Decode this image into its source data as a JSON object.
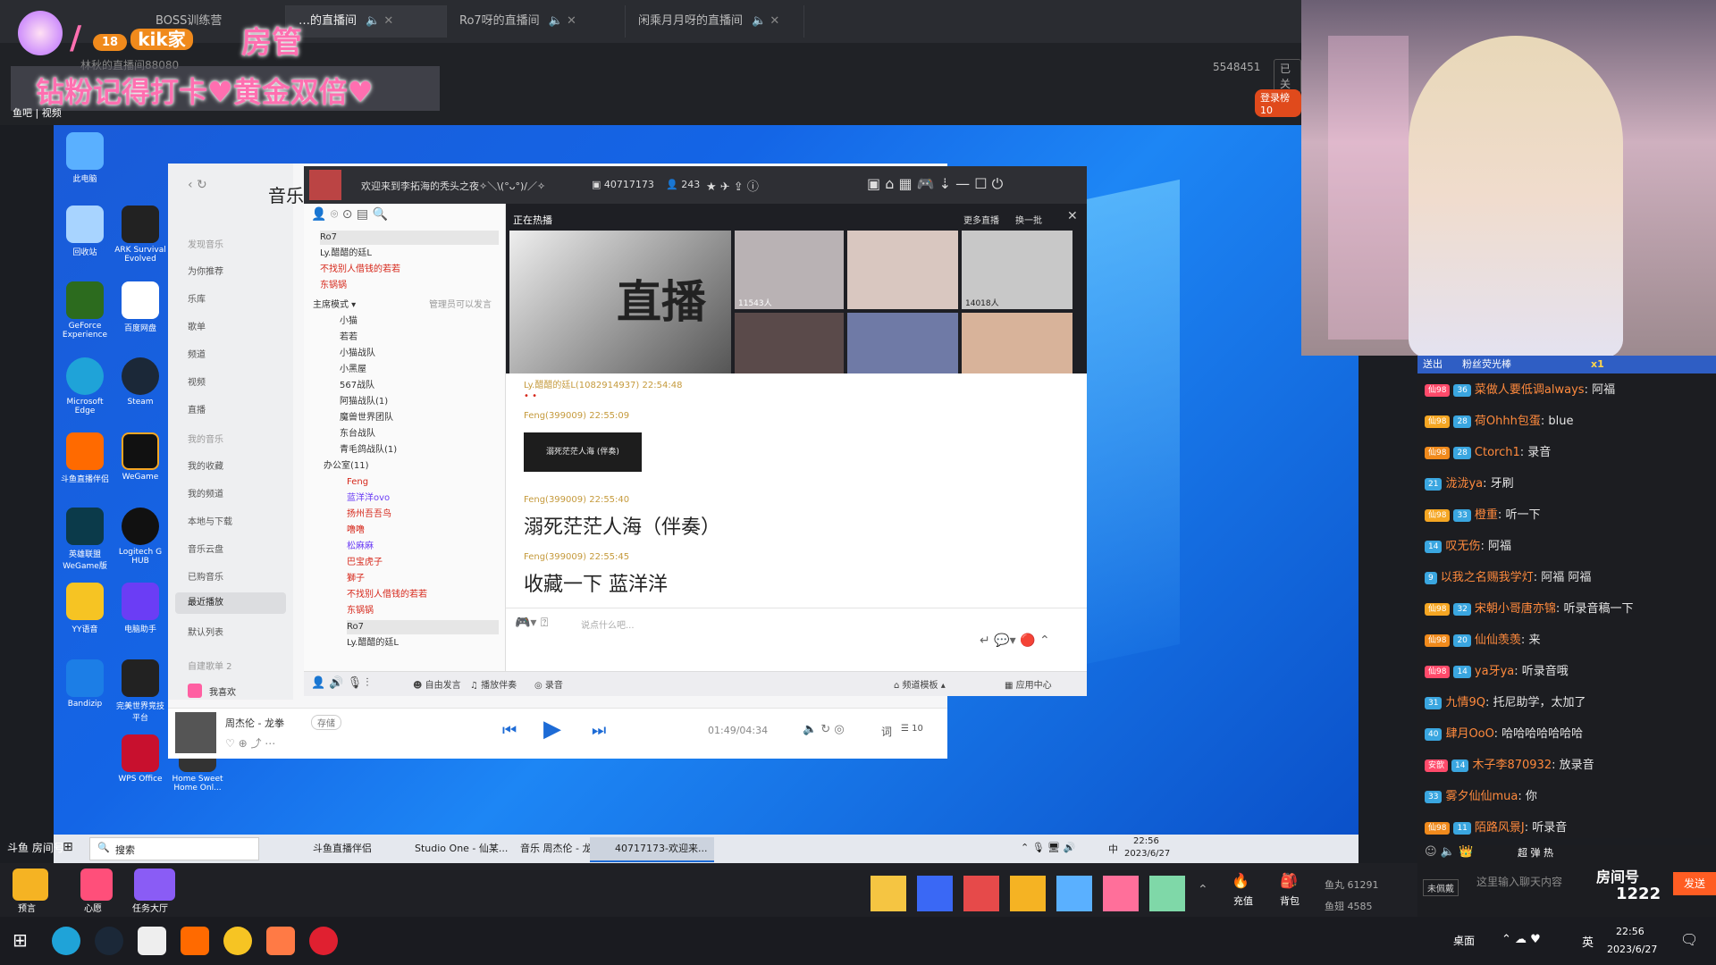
{
  "browser_tabs": [
    {
      "label": "BOSS训练营",
      "active": false
    },
    {
      "label": "…的直播间",
      "active": true
    },
    {
      "label": "Ro7呀的直播间",
      "active": false
    },
    {
      "label": "闲乘月月呀的直播间",
      "active": false
    }
  ],
  "overlay": {
    "level": "18",
    "fan_club": "kik家",
    "role": "房管",
    "banner": "钻粉记得打卡♥黄金双倍♥",
    "room_line": "林秋的直播间88080",
    "caption": "鱼吧 | 视频",
    "follow_count": "5548451",
    "follow_label": "已关",
    "rank_badge": "登录榜 10"
  },
  "desktop_icons": [
    {
      "label": "此电脑",
      "name": "this-pc-icon"
    },
    {
      "label": "回收站",
      "name": "recycle-bin-icon"
    },
    {
      "label": "ARK Survival Evolved",
      "name": "ark-icon"
    },
    {
      "label": "GeForce Experience",
      "name": "geforce-icon"
    },
    {
      "label": "百度网盘",
      "name": "baidu-pan-icon"
    },
    {
      "label": "Microsoft Edge",
      "name": "edge-icon"
    },
    {
      "label": "Steam",
      "name": "steam-icon"
    },
    {
      "label": "斗鱼直播伴侣",
      "name": "douyu-companion-icon"
    },
    {
      "label": "WeGame",
      "name": "wegame-icon"
    },
    {
      "label": "英雄联盟WeGame版",
      "name": "lol-icon"
    },
    {
      "label": "Logitech G HUB",
      "name": "ghub-icon"
    },
    {
      "label": "YY语音",
      "name": "yy-icon"
    },
    {
      "label": "电脑助手",
      "name": "pc-assistant-icon"
    },
    {
      "label": "Bandizip",
      "name": "bandizip-icon"
    },
    {
      "label": "完美世界竞技平台",
      "name": "perfect-world-icon"
    },
    {
      "label": "WPS Office",
      "name": "wps-icon"
    },
    {
      "label": "Home Sweet Home Onl...",
      "name": "home-sweet-home-icon"
    }
  ],
  "music_app": {
    "title": "音乐",
    "sections": {
      "discover": "发现音乐",
      "mine": "我的音乐",
      "created": "自建歌单 2"
    },
    "menu": [
      "为你推荐",
      "乐库",
      "歌单",
      "频道",
      "视频",
      "直播"
    ],
    "my_menu": [
      "我的收藏",
      "我的频道",
      "本地与下载",
      "音乐云盘",
      "已购音乐",
      "最近播放",
      "默认列表"
    ],
    "playlist": "我喜欢",
    "player": {
      "song": "周杰伦 - 龙拳",
      "tag": "存储",
      "time": "01:49/04:34",
      "lyrics_btn": "词",
      "queue": "10"
    }
  },
  "yy": {
    "welcome": "欢迎来到李拓海的秃头之夜✧＼\\(°ᴗ°)/／✧",
    "channel_id": "40717173",
    "online": "243",
    "hot_title": "正在热播",
    "more_live": "更多直播",
    "refresh": "换一批",
    "live_banner": "直播",
    "thumb_counts": [
      "11543人",
      "14018人"
    ],
    "admin_note": "管理员可以发言",
    "mode": "主席模式",
    "top_members": [
      "Ro7",
      "Ly.醋醋的廷L",
      "不找别人借钱的若若",
      "东锅锅"
    ],
    "groups": [
      "小猫",
      "若若",
      "小猫战队",
      "小黑屋",
      "567战队",
      "阿猫战队(1)",
      "魔兽世界团队",
      "东台战队",
      "青毛鸽战队(1)"
    ],
    "office": "办公室(11)",
    "office_members": [
      "Feng",
      "蓝洋洋ovo",
      "扬州吾吾鸟",
      "噜噜",
      "松麻麻",
      "巴宝虎子",
      "獅子",
      "不找别人借钱的若若",
      "东锅锅",
      "Ro7",
      "Ly.醋醋的廷L"
    ],
    "messages": [
      {
        "user": "Ly.醋醋的廷L(1082914937)",
        "time": "22:54:48",
        "text": "• •"
      },
      {
        "user": "Feng(399009)",
        "time": "22:55:09",
        "card": "溺死茫茫人海 (伴奏)"
      },
      {
        "user": "Feng(399009)",
        "time": "22:55:40",
        "text": "溺死茫茫人海（伴奏）"
      },
      {
        "user": "Feng(399009)",
        "time": "22:55:45",
        "text": "收藏一下  蓝洋洋"
      }
    ],
    "input_placeholder": "说点什么吧...",
    "bottom": {
      "free_speech": "自由发言",
      "accompany": "播放伴奏",
      "record": "录音",
      "channel_mode": "频道模板",
      "app_center": "应用中心"
    }
  },
  "inner_taskbar": {
    "search": "搜索",
    "items": [
      {
        "label": "斗鱼直播伴侣",
        "active": false
      },
      {
        "label": "Studio One - 仙某...",
        "active": false
      },
      {
        "label": "音乐 周杰伦 - 龙拳 ...",
        "active": false
      },
      {
        "label": "40717173-欢迎来...",
        "active": true
      }
    ],
    "ime": "中",
    "time": "22:56",
    "date": "2023/6/27"
  },
  "chat_header": {
    "left": "送出",
    "right": "粉丝荧光棒",
    "mult": "x1"
  },
  "chat": [
    {
      "lvl": "仙98",
      "badge": "36",
      "user": "菜做人要低调always",
      "msg": "阿福",
      "ucolor": "#ff8a3d"
    },
    {
      "lvl": "仙98",
      "badge": "28",
      "user": "荷Ohhh包蛋",
      "msg": "blue",
      "ucolor": "#ff8a3d"
    },
    {
      "lvl": "仙98",
      "badge": "28",
      "user": "Ctorch1",
      "msg": "录音",
      "ucolor": "#ff8a3d"
    },
    {
      "lvl": "",
      "badge": "21",
      "user": "泷泷ya",
      "msg": "牙刷",
      "ucolor": "#ff8a3d"
    },
    {
      "lvl": "仙98",
      "badge": "33",
      "user": "橙重",
      "msg": "听一下",
      "ucolor": "#ff8a3d"
    },
    {
      "lvl": "",
      "badge": "14",
      "user": "叹无伤",
      "msg": "阿福",
      "ucolor": "#ff8a3d"
    },
    {
      "lvl": "",
      "badge": "9",
      "user": "以我之名赐我学灯",
      "msg": "阿福 阿福",
      "ucolor": "#ff8a3d"
    },
    {
      "lvl": "仙98",
      "badge": "32",
      "user": "宋朝小哥唐亦锦",
      "msg": "听录音稿一下",
      "ucolor": "#ff8a3d"
    },
    {
      "lvl": "仙98",
      "badge": "20",
      "user": "仙仙羡羡",
      "msg": "来",
      "ucolor": "#ff8a3d"
    },
    {
      "lvl": "仙98",
      "badge": "14",
      "user": "ya牙ya",
      "msg": "听录音哦",
      "ucolor": "#ff8a3d"
    },
    {
      "lvl": "",
      "badge": "31",
      "user": "九情9Q",
      "msg": "托尼助学，太加了",
      "ucolor": "#ff8a3d"
    },
    {
      "lvl": "",
      "badge": "40",
      "user": "肆月OoO",
      "msg": "哈哈哈哈哈哈哈",
      "ucolor": "#ff8a3d"
    },
    {
      "lvl": "安歆",
      "badge": "14",
      "user": "木子李870932",
      "msg": "放录音",
      "ucolor": "#ff8a3d"
    },
    {
      "lvl": "",
      "badge": "33",
      "user": "雾夕仙仙mua",
      "msg": "你",
      "ucolor": "#ff8a3d"
    },
    {
      "lvl": "仙98",
      "badge": "11",
      "user": "陌路风景J",
      "msg": "听录音",
      "ucolor": "#ff8a3d"
    }
  ],
  "chat_tools": [
    "超",
    "弹",
    "热"
  ],
  "chat_input_placeholder": "这里输入聊天内容",
  "chat_send": "发送",
  "chat_unlogged": "未佩戴",
  "room_number": "1222",
  "room_label": "房间号",
  "gift_bar": {
    "buttons": [
      "预言",
      "心愿",
      "任务大厅"
    ],
    "recharge": "充值",
    "backpack": "背包",
    "fish_pill": "鱼丸",
    "fish_pill_count": "61291",
    "fish_ball": "鱼翅",
    "fish_ball_count": "4585"
  },
  "caption_bottom": "斗鱼 房间号",
  "win_taskbar": {
    "desktop": "桌面",
    "ime": "英",
    "time": "22:56",
    "date": "2023/6/27"
  }
}
